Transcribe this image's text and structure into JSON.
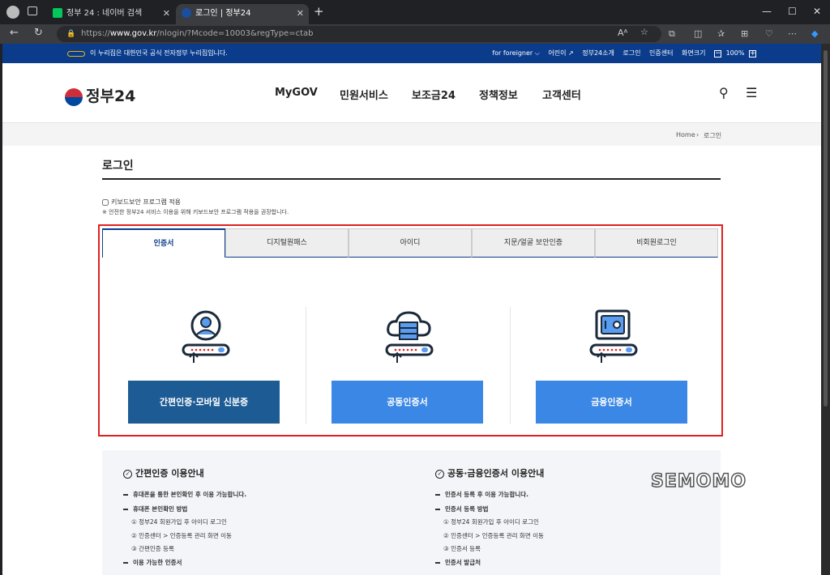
{
  "browser": {
    "tabs": [
      {
        "label": "정부 24 : 네이버 검색",
        "favicon_color": "#03c75a"
      },
      {
        "label": "로그인 | 정부24",
        "favicon_color": "#1a4fa0"
      }
    ],
    "url_prefix": "https://",
    "url_domain": "www.gov.kr",
    "url_path": "/nlogin/?Mcode=10003&regType=ctab",
    "icons": [
      "back-icon",
      "refresh-icon",
      "lock-icon",
      "read-aloud-icon",
      "favorite-icon",
      "extensions-icon",
      "split-icon",
      "favorites-icon",
      "collections-icon",
      "performance-icon",
      "more-icon",
      "copilot-icon"
    ]
  },
  "gov_bar": {
    "slogan": "이 누리집은 대한민국 공식 전자정부 누리집입니다.",
    "links": [
      "for foreigner ⌵",
      "어린이 ↗",
      "정부24소개",
      "로그인",
      "인증센터",
      "화면크기"
    ],
    "zoom_minus": "−",
    "zoom": "100%",
    "zoom_plus": "+"
  },
  "header": {
    "logo": "정부24",
    "menu": [
      "MyGOV",
      "민원서비스",
      "보조금24",
      "정책정보",
      "고객센터"
    ]
  },
  "breadcrumb": {
    "home": "Home",
    "sep": "›",
    "current": "로그인"
  },
  "login": {
    "title": "로그인",
    "keyboard_checkbox": "키보드보안 프로그램 적용",
    "keyboard_note": "※ 안전한 정부24 서비스 이용을 위해 키보드보안 프로그램 적용을 권장합니다.",
    "tabs": [
      "인증서",
      "디지털원패스",
      "아이디",
      "지문/얼굴 보안인증",
      "비회원로그인"
    ],
    "options": [
      {
        "button": "간편인증·모바일 신분증",
        "icon": "person-icon",
        "color": "#1d5b94"
      },
      {
        "button": "공동인증서",
        "icon": "cloud-server-icon",
        "color": "#3b87e6"
      },
      {
        "button": "금융인증서",
        "icon": "safe-icon",
        "color": "#3b87e6"
      }
    ]
  },
  "info": {
    "left": {
      "title": "간편인증 이용안내",
      "lines": [
        "휴대폰을 통한 본인확인 후 이용 가능합니다.",
        "휴대폰 본인확인 방법",
        "① 정부24 회원가입 후 아이디 로그인",
        "② 인증센터 > 인증등록 관리 화면 이동",
        "③ 간편인증 등록",
        "이용 가능한 인증서"
      ]
    },
    "right": {
      "title": "공동·금융인증서 이용안내",
      "lines": [
        "인증서 등록 후 이용 가능합니다.",
        "인증서 등록 방법",
        "① 정부24 회원가입 후 아이디 로그인",
        "② 인증센터 > 인증등록 관리 화면 이동",
        "③ 인증서 등록",
        "인증서 발급처"
      ]
    }
  },
  "watermark": "SEMOMO"
}
